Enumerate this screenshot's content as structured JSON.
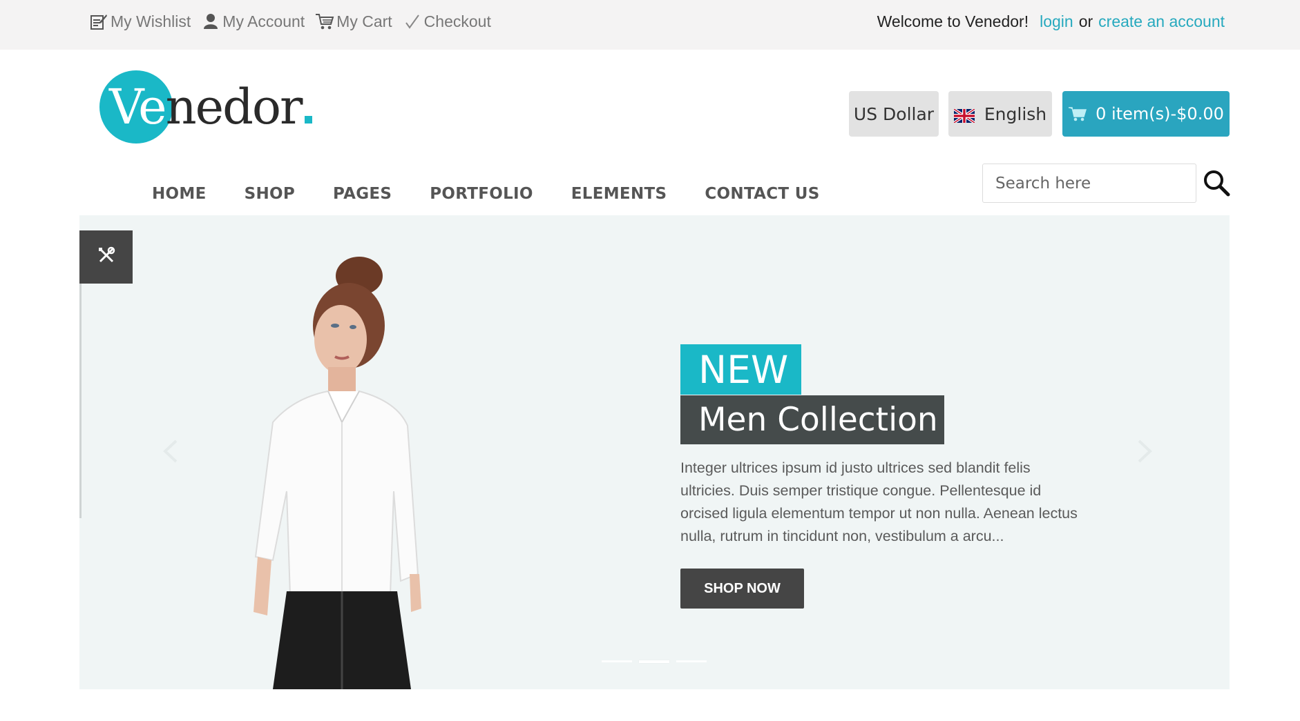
{
  "topbar": {
    "links": [
      {
        "label": "My Wishlist",
        "icon": "wishlist-icon"
      },
      {
        "label": "My Account",
        "icon": "account-icon"
      },
      {
        "label": "My Cart",
        "icon": "cart-icon"
      },
      {
        "label": "Checkout",
        "icon": "checkmark-icon"
      }
    ],
    "welcome": "Welcome to Venedor!",
    "login": "login",
    "or": "or",
    "create_account": "create an account"
  },
  "logo": {
    "prefix": "Ve",
    "suffix": "nedor",
    "accent_color": "#1ab8c7"
  },
  "header": {
    "currency": "US Dollar",
    "language": "English",
    "cart": "0 item(s)-$0.00",
    "cart_color": "#2aa5bf"
  },
  "nav": {
    "items": [
      "HOME",
      "SHOP",
      "PAGES",
      "PORTFOLIO",
      "ELEMENTS",
      "CONTACT US"
    ]
  },
  "search": {
    "placeholder": "Search here"
  },
  "hero": {
    "tag": "NEW",
    "title": "Men Collection",
    "description": "Integer ultrices ipsum id justo ultrices sed blandit felis ultricies. Duis semper tristique congue. Pellentesque id orcised ligula elementum tempor ut non nulla. Aenean lectus nulla, rutrum in tincidunt non, vestibulum a arcu...",
    "button": "SHOP NOW",
    "slide_count": 3,
    "active_slide": 2
  }
}
